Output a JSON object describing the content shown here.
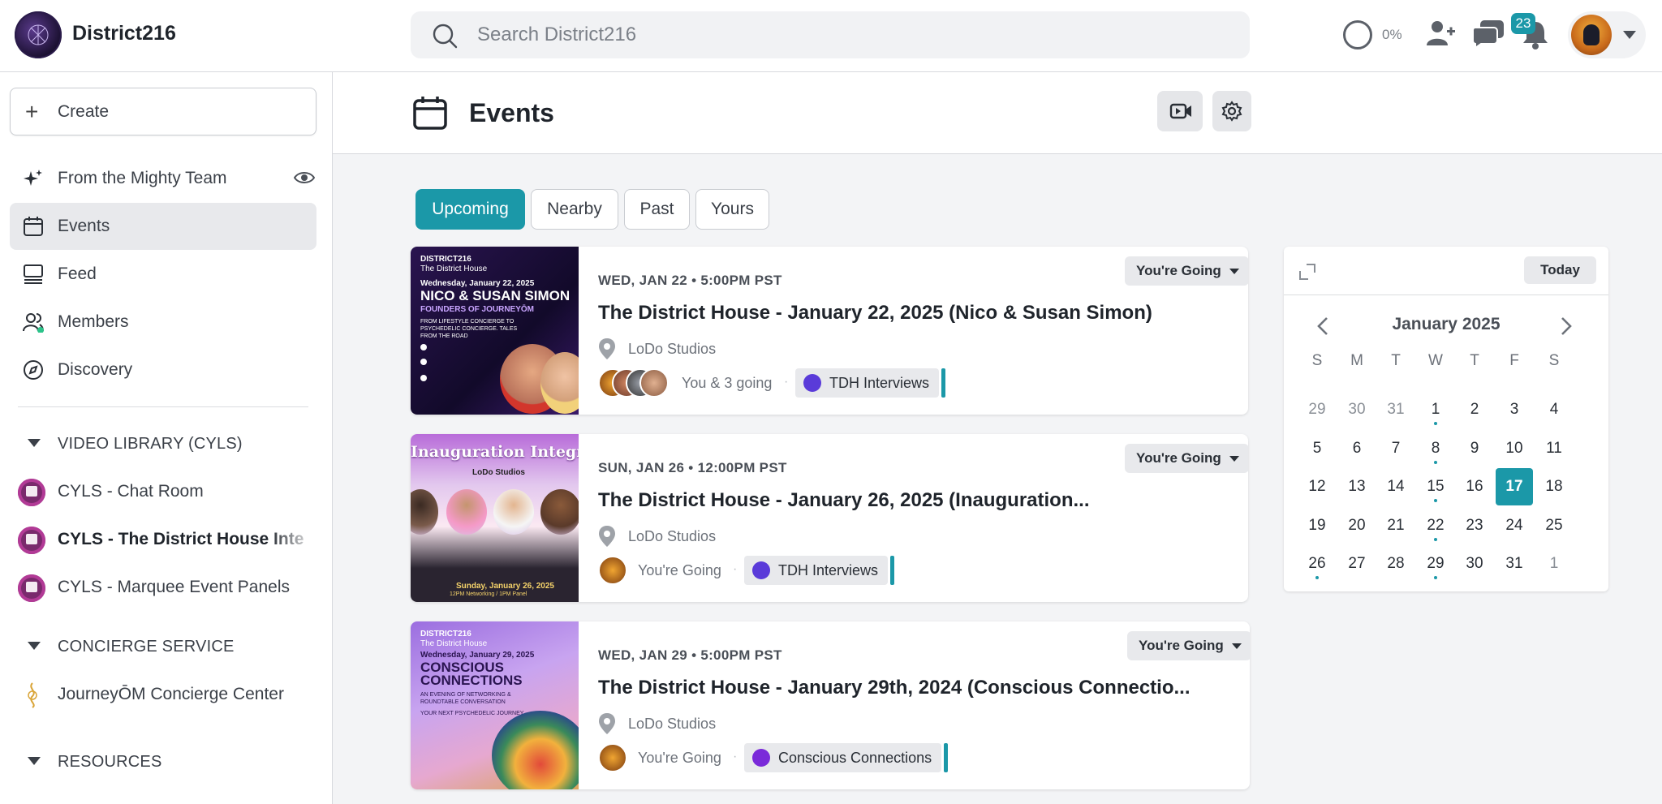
{
  "app": {
    "name": "District216"
  },
  "search": {
    "placeholder": "Search District216"
  },
  "topbar": {
    "progress_label": "0%",
    "notification_count": "23"
  },
  "sidebar": {
    "create_label": "Create",
    "items": [
      {
        "label": "From the Mighty Team",
        "icon": "sparkle-icon"
      },
      {
        "label": "Events",
        "icon": "calendar-icon"
      },
      {
        "label": "Feed",
        "icon": "feed-icon"
      },
      {
        "label": "Members",
        "icon": "members-icon"
      },
      {
        "label": "Discovery",
        "icon": "compass-icon"
      }
    ],
    "sections": [
      {
        "label": "VIDEO LIBRARY (CYLS)",
        "items": [
          "CYLS - Chat Room",
          "CYLS - The District House Inte",
          "CYLS - Marquee Event Panels"
        ]
      },
      {
        "label": "CONCIERGE SERVICE",
        "items": [
          "JourneyŌM Concierge Center"
        ]
      },
      {
        "label": "RESOURCES",
        "items": []
      }
    ]
  },
  "main": {
    "title": "Events",
    "tabs": [
      "Upcoming",
      "Nearby",
      "Past",
      "Yours"
    ],
    "events": [
      {
        "date": "WED, JAN 22 • 5:00PM PST",
        "title": "The District House - January 22, 2025 (Nico & Susan Simon)",
        "location": "LoDo Studios",
        "going": "You & 3 going",
        "tag": "TDH Interviews",
        "rsvp": "You're Going",
        "thumb": {
          "brand": "DISTRICT216",
          "sub": "The District House",
          "date": "Wednesday, January 22, 2025",
          "headline": "NICO & SUSAN SIMON",
          "tagline": "FOUNDERS OF JOURNEYŌM",
          "blurb": "FROM LIFESTYLE CONCIERGE TO PSYCHEDELIC CONCIERGE. TALES FROM THE ROAD"
        }
      },
      {
        "date": "SUN, JAN 26 • 12:00PM PST",
        "title": "The District House - January 26, 2025 (Inauguration...",
        "location": "LoDo Studios",
        "going": "You're Going",
        "tag": "TDH Interviews",
        "rsvp": "You're Going",
        "thumb": {
          "headline": "Inauguration Integration",
          "venue": "LoDo Studios",
          "date": "Sunday, January 26, 2025",
          "time": "12PM Networking / 1PM Panel"
        }
      },
      {
        "date": "WED, JAN 29 • 5:00PM PST",
        "title": "The District House - January 29th, 2024 (Conscious Connectio...",
        "location": "LoDo Studios",
        "going": "You're Going",
        "tag": "Conscious Connections",
        "rsvp": "You're Going",
        "thumb": {
          "brand": "DISTRICT216",
          "sub": "The District House",
          "date": "Wednesday, January 29, 2025",
          "headline1": "CONSCIOUS",
          "headline2": "CONNECTIONS",
          "blurb": "AN EVENING OF NETWORKING & ROUNDTABLE CONVERSATION",
          "line": "YOUR NEXT PSYCHEDELIC JOURNEY"
        }
      }
    ]
  },
  "calendar": {
    "today_label": "Today",
    "month": "January 2025",
    "weekdays": [
      "S",
      "M",
      "T",
      "W",
      "T",
      "F",
      "S"
    ],
    "weeks": [
      [
        "29",
        "30",
        "31",
        "1",
        "2",
        "3",
        "4"
      ],
      [
        "5",
        "6",
        "7",
        "8",
        "9",
        "10",
        "11"
      ],
      [
        "12",
        "13",
        "14",
        "15",
        "16",
        "17",
        "18"
      ],
      [
        "19",
        "20",
        "21",
        "22",
        "23",
        "24",
        "25"
      ],
      [
        "26",
        "27",
        "28",
        "29",
        "30",
        "31",
        "1"
      ]
    ],
    "selected": "17",
    "event_days": [
      "1",
      "8",
      "15",
      "22",
      "26",
      "29"
    ],
    "accent": "#1b98a8"
  }
}
